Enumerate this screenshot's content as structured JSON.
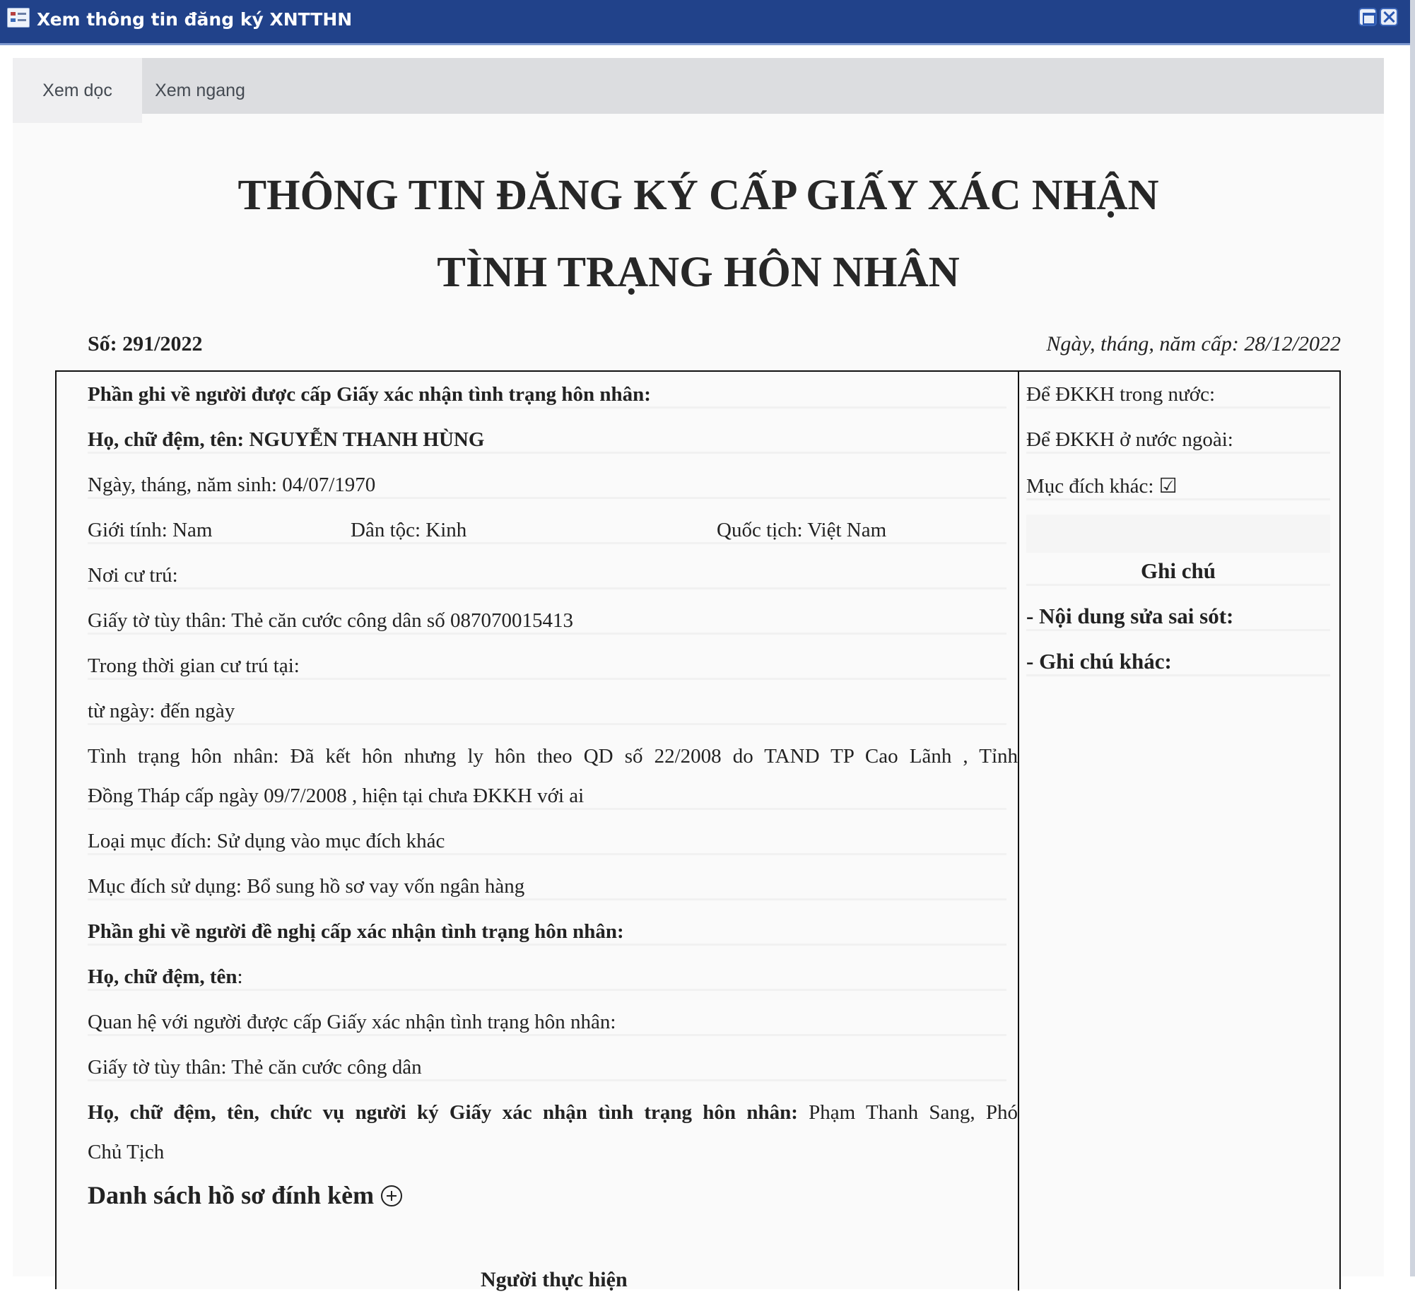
{
  "window": {
    "title": "Xem thông tin đăng ký XNTTHN"
  },
  "tabs": [
    {
      "label": "Xem dọc"
    },
    {
      "label": "Xem ngang"
    }
  ],
  "document": {
    "heading_line1": "THÔNG TIN ĐĂNG KÝ CẤP GIẤY XÁC NHẬN",
    "heading_line2": "TÌNH TRẠNG HÔN NHÂN",
    "so": "Số: 291/2022",
    "ngay_cap": "Ngày, tháng, năm cấp:  28/12/2022",
    "left": {
      "section1_title": "Phần ghi về người được cấp Giấy xác nhận tình trạng hôn nhân:",
      "ho_ten_label": "Họ, chữ đệm, tên",
      "ho_ten_value": ": NGUYỄN THANH HÙNG",
      "ngay_sinh": "Ngày, tháng, năm sinh: 04/07/1970",
      "gioi_tinh": "Giới tính: Nam",
      "dan_toc": "Dân tộc: Kinh",
      "quoc_tich": "Quốc tịch:  Việt Nam",
      "noi_cu_tru": "Nơi cư trú:",
      "giay_to": "Giấy tờ tùy thân: Thẻ căn cước công dân  số 087070015413",
      "thoi_gian_cu_tru": "Trong thời gian cư trú tại:",
      "tu_ngay": "từ ngày:  đến ngày",
      "tinh_trang_line1": "Tình trạng hôn nhân: Đã kết hôn nhưng ly hôn theo QD số 22/2008 do TAND TP Cao Lãnh , Tỉnh",
      "tinh_trang_line2": "Đồng Tháp cấp ngày 09/7/2008 , hiện tại chưa ĐKKH với ai",
      "loai_muc_dich": "Loại mục đích: Sử dụng vào mục đích khác",
      "muc_dich_su_dung": "Mục đích sử dụng: Bổ sung hồ sơ vay vốn ngân hàng",
      "section2_title": "Phần ghi về người đề nghị cấp xác nhận tình trạng hôn nhân:",
      "ho_ten2_label": "Họ, chữ đệm, tên",
      "ho_ten2_value": ":",
      "quan_he": "Quan hệ với người được cấp Giấy xác nhận tình trạng hôn nhân:",
      "giay_to2": "Giấy tờ tùy thân: Thẻ căn cước công dân",
      "nguoi_ky_label": "Họ, chữ đệm, tên, chức vụ người ký Giấy xác nhận tình trạng hôn nhân:",
      "nguoi_ky_value": " Phạm Thanh Sang, Phó",
      "nguoi_ky_line2": "Chủ Tịch",
      "attachments_title": "Danh sách hồ sơ đính kèm",
      "nguoi_thuc_hien": "Người thực hiện"
    },
    "right": {
      "dkkh_trong_nuoc": "Để ĐKKH trong nước:",
      "dkkh_nuoc_ngoai": "Để ĐKKH ở nước ngoài:",
      "muc_dich_khac": "Mục đích khác: ☑",
      "ghi_chu_title": "Ghi chú",
      "noi_dung_sua": "- Nội dung sửa sai sót:",
      "ghi_chu_khac": "- Ghi chú khác:"
    }
  }
}
